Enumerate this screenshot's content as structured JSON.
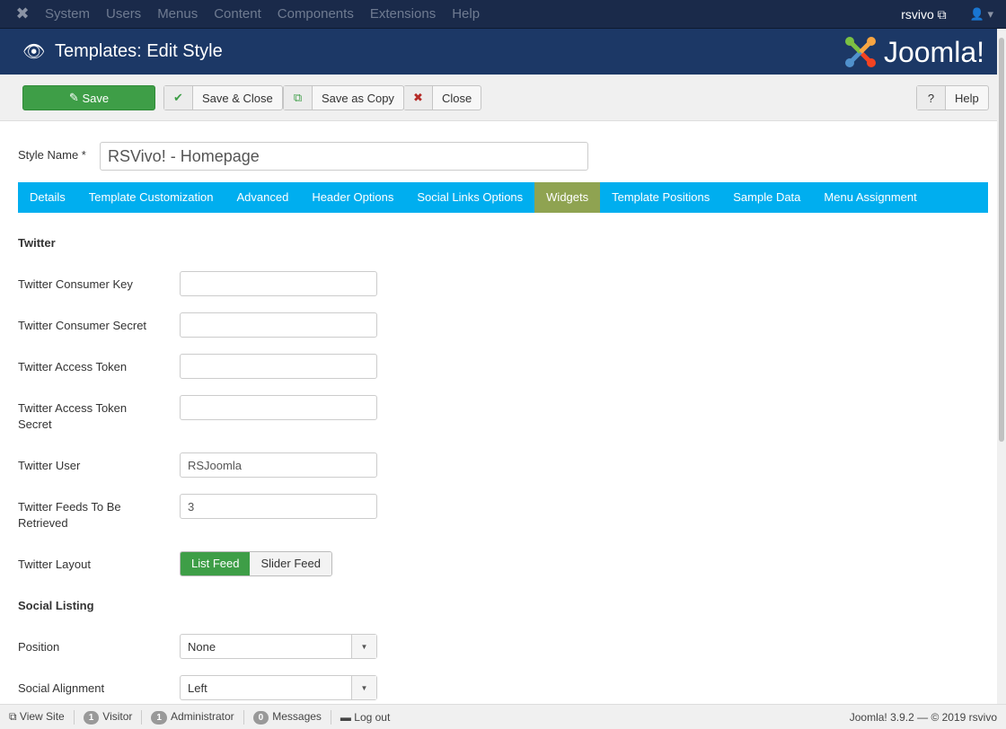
{
  "topnav": {
    "menu": [
      "System",
      "Users",
      "Menus",
      "Content",
      "Components",
      "Extensions",
      "Help"
    ],
    "user": "rsvivo"
  },
  "header": {
    "title": "Templates: Edit Style",
    "logo_text": "Joomla!"
  },
  "toolbar": {
    "save": "Save",
    "save_close": "Save & Close",
    "save_copy": "Save as Copy",
    "close": "Close",
    "help": "Help"
  },
  "style_name": {
    "label": "Style Name *",
    "value": "RSVivo! - Homepage"
  },
  "tabs": [
    {
      "label": "Details"
    },
    {
      "label": "Template Customization"
    },
    {
      "label": "Advanced"
    },
    {
      "label": "Header Options"
    },
    {
      "label": "Social Links Options"
    },
    {
      "label": "Widgets",
      "active": true
    },
    {
      "label": "Template Positions"
    },
    {
      "label": "Sample Data"
    },
    {
      "label": "Menu Assignment"
    }
  ],
  "twitter": {
    "heading": "Twitter",
    "fields": [
      {
        "label": "Twitter Consumer Key",
        "value": ""
      },
      {
        "label": "Twitter Consumer Secret",
        "value": ""
      },
      {
        "label": "Twitter Access Token",
        "value": ""
      },
      {
        "label": "Twitter Access Token Secret",
        "value": ""
      },
      {
        "label": "Twitter User",
        "value": "RSJoomla"
      },
      {
        "label": "Twitter Feeds To Be Retrieved",
        "value": "3"
      }
    ],
    "layout": {
      "label": "Twitter Layout",
      "options": [
        "List Feed",
        "Slider Feed"
      ],
      "selected": "List Feed"
    }
  },
  "social": {
    "heading": "Social Listing",
    "position": {
      "label": "Position",
      "value": "None"
    },
    "alignment": {
      "label": "Social Alignment",
      "value": "Left"
    }
  },
  "status": {
    "view_site": "View Site",
    "visitors": "1",
    "visitor_label": "Visitor",
    "admins": "1",
    "admin_label": "Administrator",
    "messages": "0",
    "messages_label": "Messages",
    "logout": "Log out",
    "version": "Joomla! 3.9.2  —  © 2019 rsvivo"
  },
  "colors": {
    "save_green": "#3e9e47",
    "tab_bar": "#00aeef",
    "tab_active": "#8fa351",
    "header": "#1c3866"
  }
}
